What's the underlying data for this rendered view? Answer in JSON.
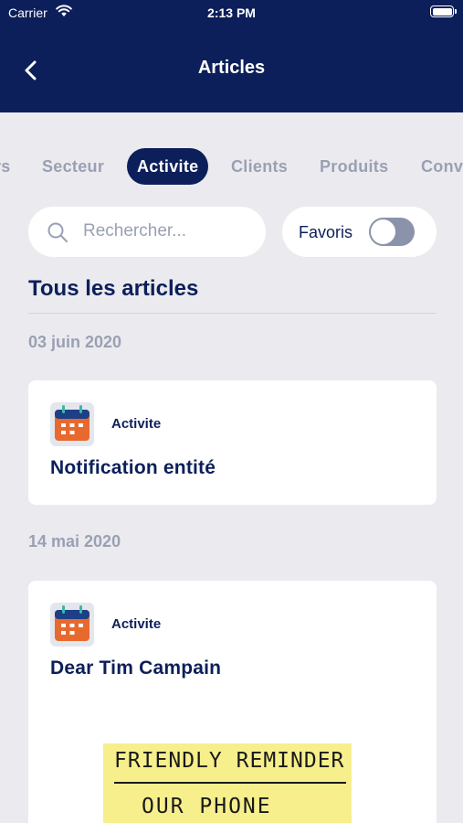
{
  "status_bar": {
    "carrier": "Carrier",
    "time": "2:13 PM"
  },
  "nav": {
    "title": "Articles"
  },
  "tabs": [
    {
      "label": "rs",
      "active": false
    },
    {
      "label": "Secteur",
      "active": false
    },
    {
      "label": "Activite",
      "active": true
    },
    {
      "label": "Clients",
      "active": false
    },
    {
      "label": "Produits",
      "active": false
    },
    {
      "label": "Conv",
      "active": false
    }
  ],
  "search": {
    "placeholder": "Rechercher...",
    "value": ""
  },
  "favoris": {
    "label": "Favoris",
    "enabled": false
  },
  "section": {
    "title": "Tous les articles"
  },
  "groups": [
    {
      "date": "03 juin 2020",
      "article": {
        "category": "Activite",
        "category_icon": "calendar-icon",
        "title": "Notification entité"
      }
    },
    {
      "date": "14 mai 2020",
      "article": {
        "category": "Activite",
        "category_icon": "calendar-icon",
        "title": "Dear Tim Campain",
        "image_text": [
          "FRIENDLY REMINDER",
          "OUR PHONE"
        ]
      }
    }
  ],
  "colors": {
    "navy": "#0c1f5a",
    "muted": "#9aa0b3",
    "background": "#ebebef",
    "calendar_orange": "#e8692e"
  }
}
